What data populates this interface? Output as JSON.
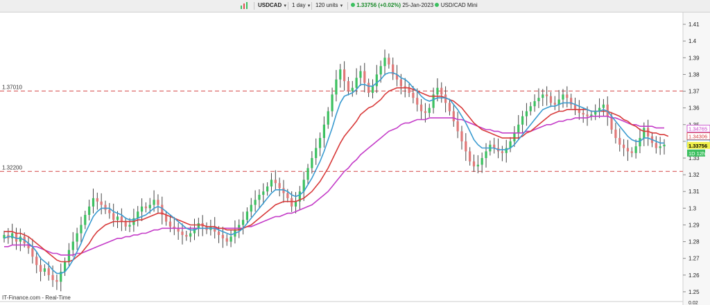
{
  "toolbar": {
    "symbol": "USDCAD",
    "interval": "1 day",
    "units": "120 units",
    "last_price": "1.33756",
    "change": "(+0.02%)",
    "date": "25-Jan-2023",
    "instrument": "USD/CAD Mini",
    "bar_chart_icon": "bar-chart-icon",
    "status_dot_icon": "green-dot-icon",
    "dropdown_icon": "chevron-down-icon"
  },
  "footer": {
    "source": "IT-Finance.com - Real-Time"
  },
  "colors": {
    "up": "#3cc060",
    "down": "#e07878",
    "ma_fast": "#3a9bd0",
    "ma_mid": "#d83a3a",
    "ma_slow": "#c43cc8",
    "level_line": "#d44444",
    "price_box": "#f0f04a",
    "timer_box": "#3cc060"
  },
  "chart_data": {
    "type": "candlestick",
    "ylim": [
      1.245,
      1.415
    ],
    "y_ticks": [
      "1.41",
      "1.4",
      "1.39",
      "1.38",
      "1.37",
      "1.36",
      "1.35",
      "1.34",
      "1.33",
      "1.32",
      "1.31",
      "1.3",
      "1.29",
      "1.28",
      "1.27",
      "1.26",
      "1.25"
    ],
    "h_lines": [
      {
        "label": "1.37010",
        "value": 1.3701
      },
      {
        "label": "1.32200",
        "value": 1.322
      }
    ],
    "price_tags": [
      {
        "label": "1.34765",
        "value": 1.34765,
        "color": "#c43cc8",
        "filled": false
      },
      {
        "label": "1.34306",
        "value": 1.34306,
        "color": "#d83a3a",
        "filled": false
      },
      {
        "label": "1.33868",
        "value": 1.33868,
        "color": "#3a9bd0",
        "filled": false
      },
      {
        "label": "1.33756",
        "value": 1.33756,
        "color": "#f0f04a",
        "filled": true
      }
    ],
    "timer_label": "1D 12h",
    "bottom_label": "0.02",
    "closes": [
      1.284,
      1.282,
      1.285,
      1.28,
      1.283,
      1.279,
      1.276,
      1.271,
      1.266,
      1.262,
      1.264,
      1.26,
      1.257,
      1.256,
      1.262,
      1.268,
      1.275,
      1.28,
      1.285,
      1.29,
      1.296,
      1.301,
      1.306,
      1.304,
      1.302,
      1.299,
      1.297,
      1.293,
      1.295,
      1.292,
      1.289,
      1.29,
      1.294,
      1.298,
      1.301,
      1.3,
      1.302,
      1.305,
      1.302,
      1.296,
      1.292,
      1.289,
      1.288,
      1.286,
      1.284,
      1.283,
      1.285,
      1.288,
      1.291,
      1.289,
      1.287,
      1.289,
      1.286,
      1.284,
      1.282,
      1.28,
      1.283,
      1.287,
      1.29,
      1.293,
      1.298,
      1.302,
      1.305,
      1.308,
      1.31,
      1.313,
      1.317,
      1.315,
      1.312,
      1.309,
      1.306,
      1.301,
      1.304,
      1.31,
      1.317,
      1.324,
      1.33,
      1.336,
      1.342,
      1.35,
      1.358,
      1.368,
      1.377,
      1.383,
      1.376,
      1.37,
      1.372,
      1.378,
      1.382,
      1.375,
      1.369,
      1.373,
      1.38,
      1.385,
      1.39,
      1.386,
      1.38,
      1.377,
      1.373,
      1.372,
      1.369,
      1.366,
      1.362,
      1.358,
      1.357,
      1.36,
      1.368,
      1.372,
      1.368,
      1.363,
      1.358,
      1.352,
      1.346,
      1.34,
      1.334,
      1.328,
      1.325,
      1.326,
      1.33,
      1.334,
      1.338,
      1.336,
      1.334,
      1.333,
      1.336,
      1.34,
      1.345,
      1.35,
      1.355,
      1.358,
      1.361,
      1.364,
      1.366,
      1.368,
      1.367,
      1.363,
      1.362,
      1.365,
      1.368,
      1.366,
      1.362,
      1.359,
      1.357,
      1.356,
      1.355,
      1.356,
      1.358,
      1.36,
      1.362,
      1.355,
      1.347,
      1.342,
      1.338,
      1.336,
      1.334,
      1.333,
      1.337,
      1.342,
      1.348,
      1.343,
      1.339,
      1.336,
      1.337,
      1.338
    ],
    "ma_fast": [
      1.282,
      1.283,
      1.283,
      1.282,
      1.282,
      1.281,
      1.279,
      1.277,
      1.274,
      1.27,
      1.268,
      1.266,
      1.263,
      1.261,
      1.261,
      1.262,
      1.265,
      1.269,
      1.274,
      1.279,
      1.285,
      1.29,
      1.295,
      1.298,
      1.3,
      1.3,
      1.3,
      1.298,
      1.297,
      1.296,
      1.294,
      1.293,
      1.293,
      1.294,
      1.295,
      1.296,
      1.298,
      1.3,
      1.301,
      1.3,
      1.298,
      1.296,
      1.294,
      1.292,
      1.29,
      1.288,
      1.287,
      1.287,
      1.288,
      1.288,
      1.288,
      1.288,
      1.288,
      1.287,
      1.286,
      1.285,
      1.284,
      1.285,
      1.286,
      1.288,
      1.291,
      1.294,
      1.297,
      1.3,
      1.303,
      1.306,
      1.309,
      1.311,
      1.311,
      1.311,
      1.31,
      1.308,
      1.307,
      1.308,
      1.31,
      1.314,
      1.318,
      1.323,
      1.328,
      1.334,
      1.341,
      1.348,
      1.356,
      1.363,
      1.367,
      1.368,
      1.369,
      1.371,
      1.374,
      1.374,
      1.373,
      1.373,
      1.375,
      1.377,
      1.38,
      1.381,
      1.381,
      1.38,
      1.378,
      1.377,
      1.375,
      1.372,
      1.37,
      1.367,
      1.365,
      1.364,
      1.365,
      1.366,
      1.366,
      1.366,
      1.365,
      1.362,
      1.359,
      1.355,
      1.351,
      1.346,
      1.341,
      1.338,
      1.336,
      1.336,
      1.336,
      1.336,
      1.335,
      1.335,
      1.335,
      1.336,
      1.338,
      1.341,
      1.344,
      1.347,
      1.35,
      1.353,
      1.356,
      1.359,
      1.36,
      1.361,
      1.361,
      1.362,
      1.363,
      1.363,
      1.363,
      1.362,
      1.361,
      1.36,
      1.359,
      1.358,
      1.358,
      1.358,
      1.359,
      1.358,
      1.355,
      1.352,
      1.349,
      1.346,
      1.343,
      1.341,
      1.34,
      1.34,
      1.342,
      1.342,
      1.341,
      1.34,
      1.339,
      1.339
    ],
    "ma_mid": [
      1.286,
      1.286,
      1.286,
      1.285,
      1.285,
      1.284,
      1.283,
      1.281,
      1.279,
      1.277,
      1.275,
      1.273,
      1.271,
      1.269,
      1.268,
      1.268,
      1.268,
      1.269,
      1.271,
      1.273,
      1.276,
      1.279,
      1.283,
      1.286,
      1.288,
      1.29,
      1.291,
      1.292,
      1.292,
      1.292,
      1.292,
      1.292,
      1.292,
      1.293,
      1.293,
      1.294,
      1.295,
      1.296,
      1.297,
      1.297,
      1.296,
      1.295,
      1.294,
      1.293,
      1.292,
      1.291,
      1.29,
      1.29,
      1.29,
      1.29,
      1.289,
      1.289,
      1.289,
      1.288,
      1.288,
      1.287,
      1.287,
      1.287,
      1.287,
      1.288,
      1.289,
      1.29,
      1.292,
      1.294,
      1.296,
      1.298,
      1.3,
      1.302,
      1.303,
      1.304,
      1.304,
      1.304,
      1.304,
      1.305,
      1.306,
      1.308,
      1.31,
      1.313,
      1.316,
      1.32,
      1.324,
      1.329,
      1.334,
      1.339,
      1.343,
      1.346,
      1.349,
      1.352,
      1.356,
      1.358,
      1.36,
      1.361,
      1.363,
      1.365,
      1.368,
      1.37,
      1.371,
      1.372,
      1.372,
      1.372,
      1.372,
      1.371,
      1.37,
      1.369,
      1.368,
      1.367,
      1.367,
      1.367,
      1.367,
      1.366,
      1.365,
      1.364,
      1.362,
      1.36,
      1.357,
      1.354,
      1.351,
      1.349,
      1.347,
      1.346,
      1.345,
      1.344,
      1.343,
      1.342,
      1.342,
      1.342,
      1.342,
      1.342,
      1.343,
      1.345,
      1.346,
      1.348,
      1.35,
      1.352,
      1.354,
      1.356,
      1.357,
      1.358,
      1.358,
      1.359,
      1.359,
      1.359,
      1.359,
      1.359,
      1.359,
      1.358,
      1.358,
      1.358,
      1.358,
      1.358,
      1.357,
      1.356,
      1.355,
      1.353,
      1.352,
      1.35,
      1.349,
      1.347,
      1.346,
      1.346,
      1.345,
      1.345,
      1.344,
      1.344,
      1.343
    ],
    "ma_slow": [
      1.277,
      1.277,
      1.278,
      1.278,
      1.278,
      1.278,
      1.278,
      1.277,
      1.277,
      1.276,
      1.275,
      1.274,
      1.273,
      1.273,
      1.272,
      1.272,
      1.272,
      1.272,
      1.273,
      1.273,
      1.274,
      1.275,
      1.276,
      1.277,
      1.278,
      1.279,
      1.28,
      1.281,
      1.282,
      1.282,
      1.283,
      1.283,
      1.284,
      1.284,
      1.285,
      1.285,
      1.286,
      1.287,
      1.287,
      1.288,
      1.288,
      1.288,
      1.288,
      1.288,
      1.288,
      1.288,
      1.288,
      1.288,
      1.288,
      1.288,
      1.288,
      1.288,
      1.288,
      1.288,
      1.288,
      1.288,
      1.288,
      1.288,
      1.288,
      1.288,
      1.289,
      1.289,
      1.29,
      1.291,
      1.292,
      1.293,
      1.294,
      1.295,
      1.295,
      1.296,
      1.297,
      1.297,
      1.298,
      1.299,
      1.3,
      1.301,
      1.302,
      1.304,
      1.306,
      1.308,
      1.31,
      1.313,
      1.316,
      1.319,
      1.322,
      1.324,
      1.327,
      1.329,
      1.332,
      1.334,
      1.336,
      1.338,
      1.34,
      1.342,
      1.344,
      1.346,
      1.347,
      1.348,
      1.35,
      1.351,
      1.351,
      1.352,
      1.353,
      1.353,
      1.353,
      1.354,
      1.354,
      1.354,
      1.354,
      1.354,
      1.354,
      1.354,
      1.353,
      1.353,
      1.352,
      1.351,
      1.35,
      1.349,
      1.348,
      1.347,
      1.347,
      1.346,
      1.346,
      1.345,
      1.345,
      1.345,
      1.345,
      1.345,
      1.345,
      1.346,
      1.346,
      1.347,
      1.348,
      1.349,
      1.35,
      1.35,
      1.351,
      1.352,
      1.352,
      1.353,
      1.353,
      1.354,
      1.354,
      1.354,
      1.354,
      1.355,
      1.355,
      1.355,
      1.355,
      1.355,
      1.354,
      1.354,
      1.353,
      1.352,
      1.351,
      1.35,
      1.35,
      1.349,
      1.349,
      1.349,
      1.349,
      1.348,
      1.348,
      1.348
    ]
  }
}
